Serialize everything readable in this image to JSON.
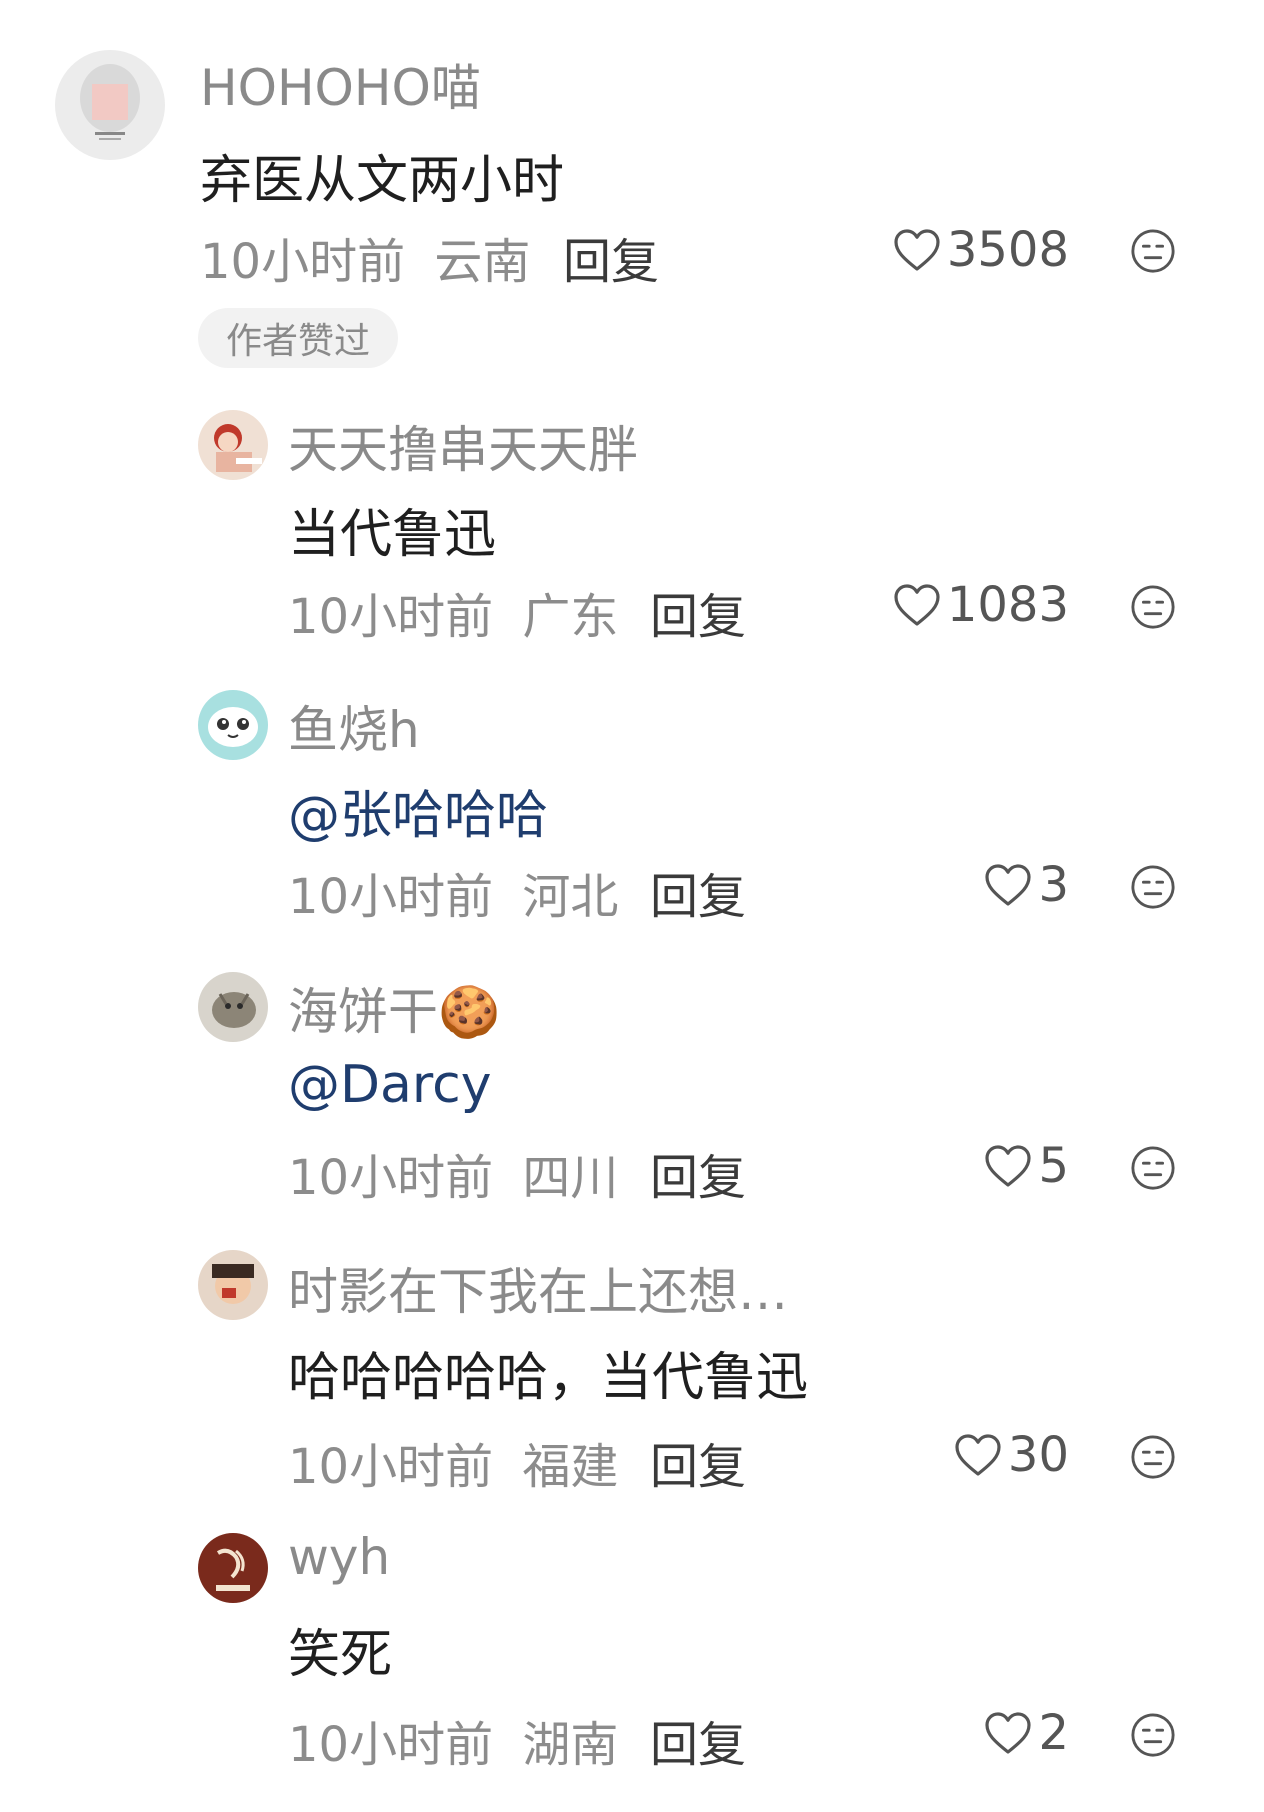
{
  "comments": [
    {
      "username": "HOHOHO喵",
      "text": "弃医从文两小时",
      "time": "10小时前",
      "location": "云南",
      "reply_label": "回复",
      "likes": "3508",
      "badge": "作者赞过"
    },
    {
      "username": "天天撸串天天胖",
      "text": "当代鲁迅",
      "time": "10小时前",
      "location": "广东",
      "reply_label": "回复",
      "likes": "1083"
    },
    {
      "username": "鱼烧h",
      "text": "@张哈哈哈",
      "time": "10小时前",
      "location": "河北",
      "reply_label": "回复",
      "likes": "3"
    },
    {
      "username": "海饼干🍪",
      "text": "@Darcy",
      "time": "10小时前",
      "location": "四川",
      "reply_label": "回复",
      "likes": "5"
    },
    {
      "username": "时影在下我在上还想…",
      "text": "哈哈哈哈哈，当代鲁迅",
      "time": "10小时前",
      "location": "福建",
      "reply_label": "回复",
      "likes": "30"
    },
    {
      "username": "wyh",
      "text": "笑死",
      "time": "10小时前",
      "location": "湖南",
      "reply_label": "回复",
      "likes": "2"
    }
  ],
  "icons": {
    "like": "heart-outline-icon",
    "dislike": "neutral-face-icon"
  },
  "colors": {
    "mention": "#1f3d6e",
    "meta": "#8c8c8c",
    "username": "#8a8a8a",
    "badge_bg": "#f2f2f2"
  }
}
